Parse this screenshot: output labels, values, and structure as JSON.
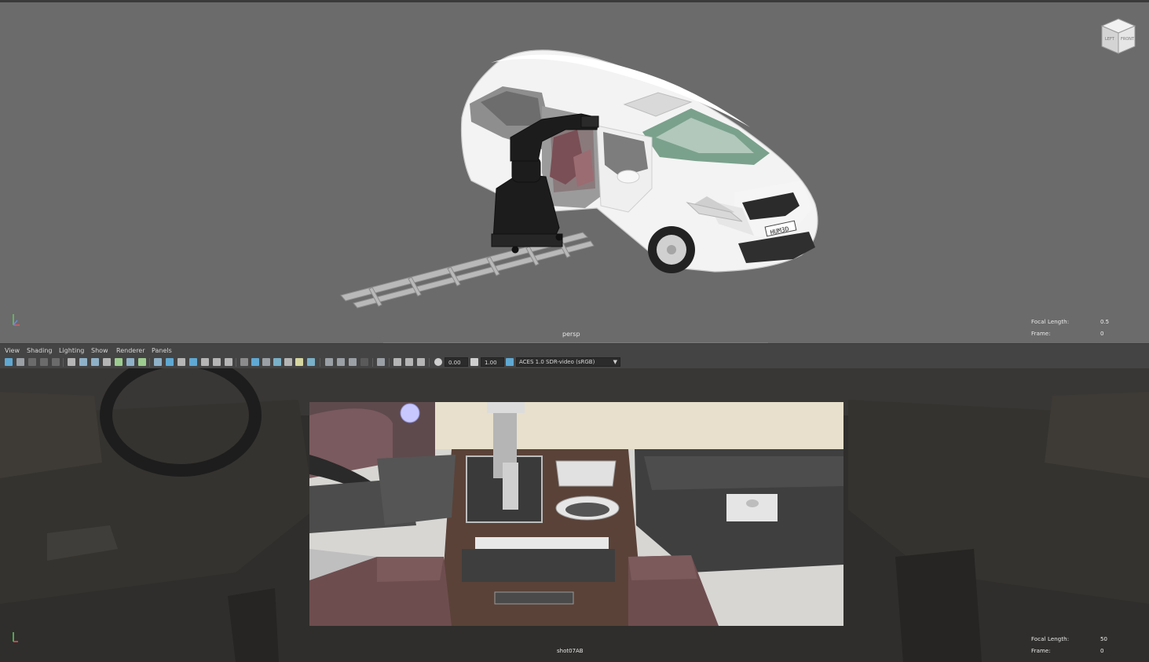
{
  "top_viewport": {
    "camera": "persp",
    "hud": {
      "focal_length_label": "Focal Length:",
      "focal_length_value": "0.5",
      "frame_label": "Frame:",
      "frame_value": "0"
    },
    "view_cube": {
      "left_face": "LEFT",
      "front_face": "FRONT"
    },
    "license_plate": "HUM3D"
  },
  "panel_menu": [
    "View",
    "Shading",
    "Lighting",
    "Show",
    "Renderer",
    "Panels"
  ],
  "panel_toolbar": {
    "exposure_value": "0.00",
    "gamma_value": "1.00",
    "color_space": "ACES 1.0 SDR-video (sRGB)",
    "icons": [
      "select-camera-icon",
      "camera-attributes-icon",
      "bookmark-icon",
      "image-plane-icon",
      "grid-icon",
      "film-gate-icon",
      "resolution-gate-icon",
      "gate-mask-icon",
      "field-chart-icon",
      "safe-action-icon",
      "safe-title-icon",
      "wireframe-icon",
      "smooth-shade-icon",
      "default-material-icon",
      "textured-icon",
      "lights-icon",
      "shadows-icon",
      "ambient-occlusion-icon",
      "motion-blur-icon",
      "anti-aliasing-icon",
      "depth-of-field-icon",
      "isolate-select-icon",
      "xray-icon",
      "xray-joints-icon",
      "xray-components-icon",
      "exposure-icon",
      "gamma-icon",
      "view-transform-icon"
    ]
  },
  "bottom_viewport": {
    "camera": "shot07AB",
    "hud": {
      "focal_length_label": "Focal Length:",
      "focal_length_value": "50",
      "frame_label": "Frame:",
      "frame_value": "0"
    }
  },
  "colors": {
    "viewport_bg": "#6b6b6b",
    "panel_bg": "#444444",
    "field_bg": "#2b2b2b",
    "active_icon": "#5fa8d3"
  }
}
